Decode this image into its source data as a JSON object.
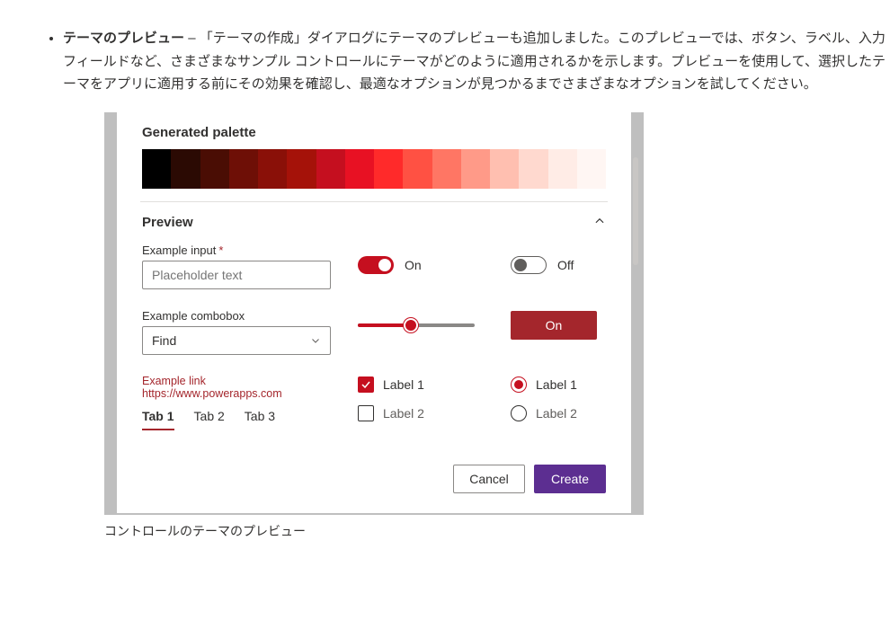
{
  "bullet": {
    "title": "テーマのプレビュー",
    "dash": "–",
    "body": "「テーマの作成」ダイアログにテーマのプレビューも追加しました。このプレビューでは、ボタン、ラベル、入力フィールドなど、さまざまなサンプル コントロールにテーマがどのように適用されるかを示します。プレビューを使用して、選択したテーマをアプリに適用する前にその効果を確認し、最適なオプションが見つかるまでさまざまなオプションを試してください。"
  },
  "caption": "コントロールのテーマのプレビュー",
  "dialog": {
    "palette_label": "Generated palette",
    "swatches": [
      "#000000",
      "#2b0a03",
      "#4a0d04",
      "#6e0f06",
      "#8a1008",
      "#a51209",
      "#c50f1f",
      "#e81123",
      "#ff2a2a",
      "#ff5143",
      "#ff7664",
      "#ff9a88",
      "#ffbfb0",
      "#ffd9cf",
      "#ffece6",
      "#fff6f3"
    ],
    "preview_label": "Preview",
    "input": {
      "label": "Example input",
      "required": "*",
      "placeholder": "Placeholder text"
    },
    "combo": {
      "label": "Example combobox",
      "value": "Find"
    },
    "toggle_on": "On",
    "toggle_off": "Off",
    "on_button": "On",
    "example_link": "Example link https://www.powerapps.com",
    "tabs": [
      "Tab 1",
      "Tab 2",
      "Tab 3"
    ],
    "checks": [
      "Label 1",
      "Label 2"
    ],
    "radios": [
      "Label 1",
      "Label 2"
    ],
    "cancel": "Cancel",
    "create": "Create"
  }
}
